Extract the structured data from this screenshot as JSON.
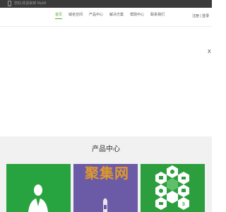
{
  "topbar": {
    "welcome_text": "您好,欢迎来到 MyAll"
  },
  "header": {
    "nav": [
      {
        "label": "首页",
        "active": true
      },
      {
        "label": "域名空间"
      },
      {
        "label": "产品中心"
      },
      {
        "label": "解决方案"
      },
      {
        "label": "帮助中心"
      },
      {
        "label": "联系我们"
      }
    ],
    "login_label": "注册",
    "separator": "|",
    "register_label": "登录"
  },
  "banner": {
    "close_label": "X"
  },
  "products": {
    "section_title": "产品中心",
    "cards": [
      {
        "icon": "user-icon",
        "color": "#27a43f"
      },
      {
        "icon": "rocket-icon",
        "color": "#6b5aa6"
      },
      {
        "icon": "hexagon-services-icon",
        "color": "#2c9e3e"
      }
    ]
  },
  "watermark": {
    "text": "聚集网"
  },
  "colors": {
    "accent": "#5aa632",
    "topbar": "#3a3a3a",
    "band": "#f1f1f1"
  }
}
